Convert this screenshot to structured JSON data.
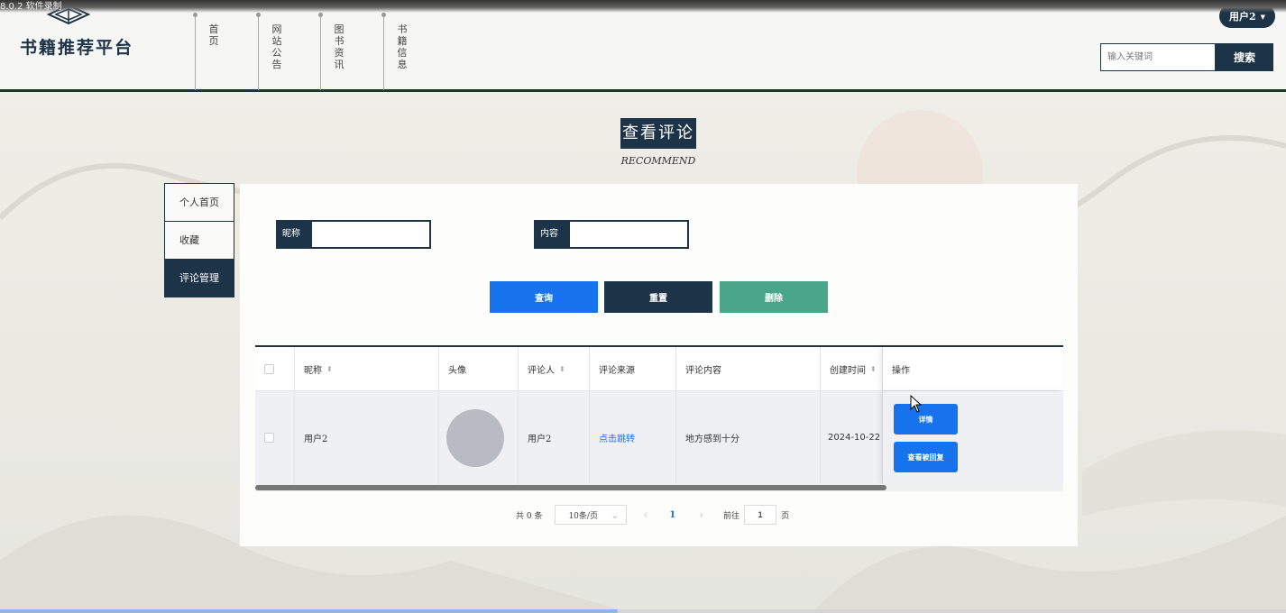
{
  "top_strip_text": "8.0.2 软件录制",
  "header": {
    "site_title": "书籍推荐平台",
    "nav": [
      "首页",
      "网站公告",
      "图书资讯",
      "书籍信息"
    ],
    "user": "用户2",
    "search_placeholder": "输入关键词",
    "search_button": "搜索"
  },
  "page": {
    "title": "查看评论",
    "subtitle": "RECOMMEND"
  },
  "side_menu": [
    {
      "label": "个人首页",
      "active": false
    },
    {
      "label": "收藏",
      "active": false
    },
    {
      "label": "评论管理",
      "active": true
    }
  ],
  "filters": {
    "nickname_label": "昵称",
    "nickname_value": "",
    "content_label": "内容",
    "content_value": ""
  },
  "actions": {
    "query": "查询",
    "reset": "重置",
    "delete": "删除"
  },
  "table": {
    "headers": [
      "昵称",
      "头像",
      "评论人",
      "评论来源",
      "评论内容",
      "创建时间",
      "操作"
    ],
    "rows": [
      {
        "nickname": "用户2",
        "commenter": "用户2",
        "source": "点击跳转",
        "content": "地方感到十分",
        "created": "2024-10-22",
        "op_detail": "详情",
        "op_reply": "查看被回复"
      }
    ]
  },
  "pagination": {
    "total": "共 0 条",
    "page_size": "10条/页",
    "current_page": "1",
    "goto_label": "前往",
    "goto_value": "1",
    "page_unit": "页"
  },
  "colors": {
    "primary_dark": "#1d3347",
    "accent_blue": "#1772ee",
    "delete_green": "#4aa688"
  }
}
